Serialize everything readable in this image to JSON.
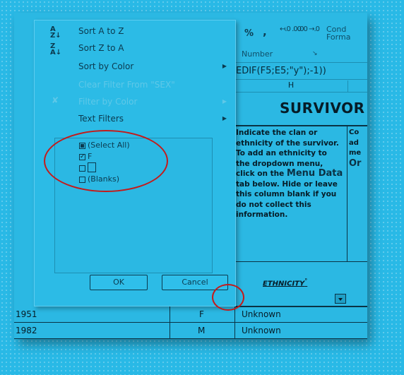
{
  "ribbon": {
    "percent": "%",
    "comma": ",",
    "increase_decimal": "↤.0 .00",
    "decrease_decimal": ".00 →.0",
    "conditional_formatting": "Cond\nForma",
    "group_label": "Number"
  },
  "formula_bar": {
    "text": "EDIF(F5;E5;\"y\");-1))"
  },
  "column_header": "H",
  "sheet": {
    "title": "SURVIVOR",
    "instructions_part1": "Indicate the clan or ethnicity of the survivor. To add an ethnicity to the dropdown menu, click on the ",
    "instructions_menu_data": "Menu Data",
    "instructions_part2": " tab below. Hide or leave this column blank if you do not collect this information.",
    "next_col_text": [
      "Co",
      "ad",
      "",
      "me",
      "Or"
    ],
    "ethnicity_header": "ETHNICITY",
    "ethnicity_mark": "°",
    "rows": [
      {
        "year": "1951",
        "sex": "F",
        "ethnicity": "Unknown"
      },
      {
        "year": "1982",
        "sex": "M",
        "ethnicity": "Unknown"
      }
    ]
  },
  "filter_menu": {
    "sort_az": "Sort A to Z",
    "sort_za": "Sort Z to A",
    "sort_by_color": "Sort by Color",
    "clear_filter": "Clear Filter From \"SEX\"",
    "filter_by_color": "Filter by Color",
    "text_filters": "Text Filters",
    "list": [
      {
        "label": "(Select All)",
        "state": "partial"
      },
      {
        "label": "F",
        "state": "checked"
      },
      {
        "label": "",
        "state": "unchecked"
      },
      {
        "label": "(Blanks)",
        "state": "unchecked"
      }
    ],
    "ok": "OK",
    "cancel": "Cancel"
  },
  "colors": {
    "background": "#29b9e6",
    "annotation": "#c41a1a",
    "text": "#0b3a4f",
    "disabled": "#5fc8e8"
  }
}
